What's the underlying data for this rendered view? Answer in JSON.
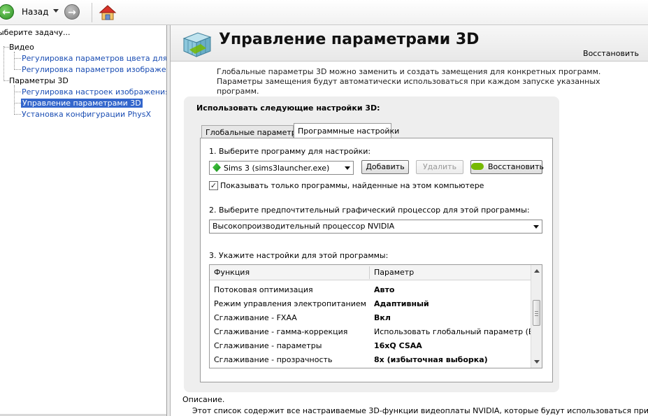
{
  "toolbar": {
    "back_label": "Назад"
  },
  "left_panel": {
    "task_title": "ыберите задачу...",
    "categories": [
      {
        "label": "Видео",
        "items": [
          {
            "label": "Регулировка параметров цвета для вид",
            "selected": false
          },
          {
            "label": "Регулировка параметров изображения д",
            "selected": false
          }
        ]
      },
      {
        "label": "Параметры 3D",
        "items": [
          {
            "label": "Регулировка настроек изображения с пр",
            "selected": false
          },
          {
            "label": "Управление параметрами 3D",
            "selected": true
          },
          {
            "label": "Установка конфигурации PhysX",
            "selected": false
          }
        ]
      }
    ]
  },
  "header": {
    "title": "Управление параметрами 3D",
    "restore_label": "Восстановить"
  },
  "intro_text": "Глобальные параметры 3D можно заменить и создать замещения для конкретных программ. Параметры замещения будут автоматически использоваться при каждом запуске указанных программ.",
  "settings": {
    "heading": "Использовать следующие настройки 3D:",
    "tabs": [
      {
        "label": "Глобальные параметры",
        "active": false
      },
      {
        "label": "Программные настройки",
        "active": true
      }
    ],
    "step1": {
      "label": "1. Выберите программу для настройки:",
      "selected_program": "Sims 3 (sims3launcher.exe)",
      "add_button": "Добавить",
      "remove_button": "Удалить",
      "restore_button": "Восстановить",
      "show_only_checkbox": {
        "checked": true,
        "label": "Показывать только программы, найденные на этом компьютере"
      }
    },
    "step2": {
      "label": "2. Выберите предпочтительный графический процессор для этой программы:",
      "selected_gpu": "Высокопроизводительный процессор NVIDIA"
    },
    "step3": {
      "label": "3. Укажите настройки для этой программы:",
      "columns": [
        "Функция",
        "Параметр"
      ],
      "rows": [
        {
          "function": "Потоковая оптимизация",
          "value": "Авто",
          "bold": true
        },
        {
          "function": "Режим управления электропитанием",
          "value": "Адаптивный",
          "bold": true
        },
        {
          "function": "Сглаживание - FXAA",
          "value": "Вкл",
          "bold": true
        },
        {
          "function": "Сглаживание - гамма-коррекция",
          "value": "Использовать глобальный параметр (Вкл)",
          "bold": false
        },
        {
          "function": "Сглаживание - параметры",
          "value": "16xQ CSAA",
          "bold": true
        },
        {
          "function": "Сглаживание - прозрачность",
          "value": "8x (избыточная выборка)",
          "bold": true
        }
      ]
    }
  },
  "description": {
    "label": "Описание.",
    "text": "Этот список содержит все настраиваемые 3D-функции видеоплаты NVIDIA, которые будут использоваться при"
  },
  "colors": {
    "link": "#1a4db3",
    "selection": "#3366cc",
    "nvidia_green": "#76b900",
    "back_button": "#2a8f23"
  },
  "icons": {
    "back": "back-arrow-icon",
    "forward": "forward-arrow-icon",
    "home": "home-icon",
    "header": "3d-cube-icon",
    "program": "sims-plumbob-icon",
    "nvidia": "nvidia-logo-icon"
  }
}
